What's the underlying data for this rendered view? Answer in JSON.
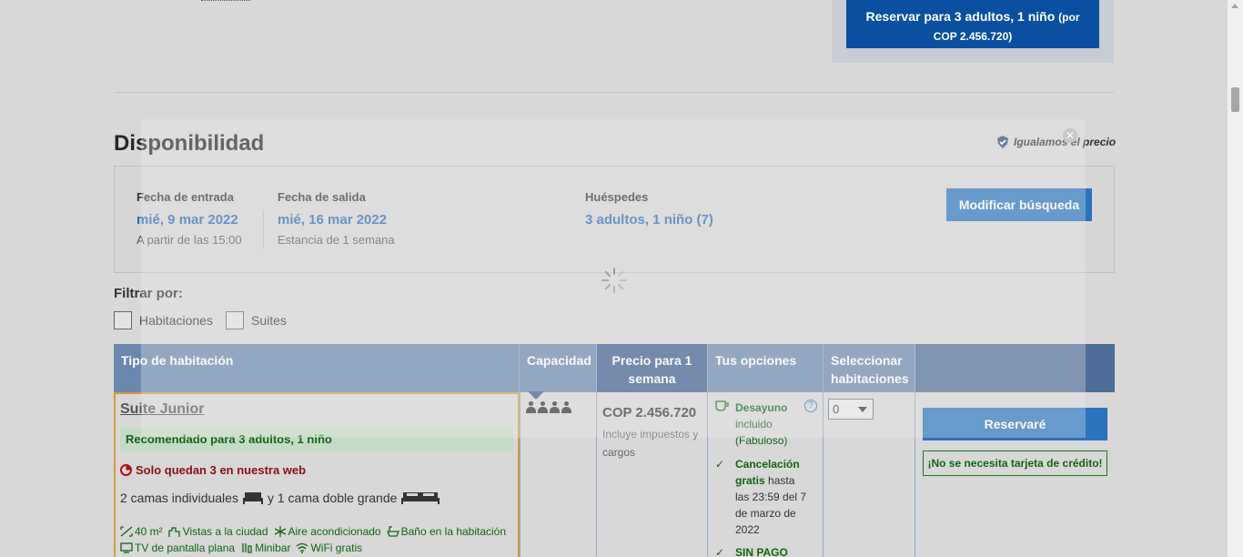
{
  "top_reserve": {
    "label": "Reservar para 3 adultos, 1 niño",
    "label_suffix": "(por",
    "price": "COP 2.456.720)"
  },
  "section": {
    "title": "Disponibilidad",
    "price_match": "Igualamos el precio"
  },
  "search": {
    "checkin_label": "Fecha de entrada",
    "checkin_value": "mié, 9 mar 2022",
    "checkin_sub": "A partir de las 15:00",
    "checkout_label": "Fecha de salida",
    "checkout_value": "mié, 16 mar 2022",
    "checkout_sub": "Estancia de 1 semana",
    "guests_label": "Huéspedes",
    "guests_value": "3 adultos, 1 niño (7)",
    "modify_button": "Modificar búsqueda"
  },
  "filter": {
    "label": "Filtrar por:",
    "options": [
      "Habitaciones",
      "Suites"
    ]
  },
  "table": {
    "headers": {
      "room_type": "Tipo de habitación",
      "capacity": "Capacidad",
      "price": "Precio para 1 semana",
      "options": "Tus opciones",
      "select": "Seleccionar habitaciones"
    },
    "row": {
      "room_name": "Suite Junior",
      "recommended": "Recomendado para 3 adultos, 1 niño",
      "scarcity": "Solo quedan 3 en nuestra web",
      "beds_part1": "2 camas individuales",
      "beds_part2": "y 1 cama doble grande",
      "facilities": [
        "40 m²",
        "Vistas a la ciudad",
        "Aire acondicionado",
        "Baño en la habitación",
        "TV de pantalla plana",
        "Minibar",
        "WiFi gratis"
      ],
      "capacity_count": 4,
      "price": "COP 2.456.720",
      "price_note": "Incluye impuestos y cargos",
      "option_breakfast_title": "Desayuno",
      "option_breakfast_rest": "incluido (Fabuloso)",
      "option_cancel_bold": "Cancelación gratis",
      "option_cancel_rest": "hasta las 23:59 del 7 de marzo de 2022",
      "option_nopay": "SIN PAGO",
      "select_value": "0",
      "reserve_button": "Reservaré",
      "no_card": "¡No se necesita tarjeta de crédito!"
    }
  },
  "colors": {
    "primary_blue": "#2a74bb",
    "dark_blue": "#0a4fa0",
    "header_blue": "#6a87ad",
    "green": "#106610",
    "red": "#8a1010"
  }
}
